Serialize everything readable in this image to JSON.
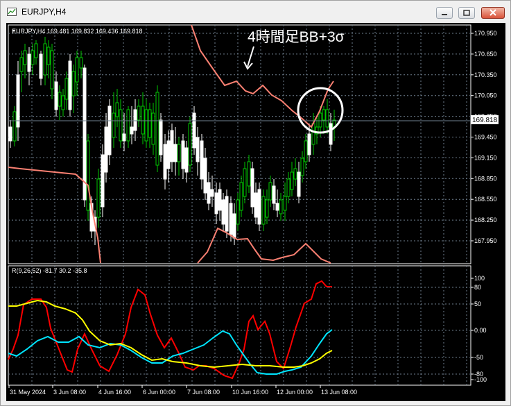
{
  "window": {
    "title": "EURJPY,H4"
  },
  "main_chart": {
    "info_line": "EURJPY,H4  169.481 169.832 169.436 169.818",
    "annotation": "4時間足BB+3σ",
    "current_price": "169.818",
    "price_ticks": [
      "170.950",
      "170.650",
      "170.350",
      "170.050",
      "169.750",
      "169.450",
      "169.150",
      "168.850",
      "168.550",
      "168.250",
      "167.950"
    ]
  },
  "indicator": {
    "label": "R(9,26,52) -81.7 30.2 -35.8",
    "ticks": [
      "100",
      "80",
      "50",
      "0.00",
      "-50",
      "-80",
      "-100"
    ]
  },
  "time_axis": {
    "labels": [
      "31 May 2024",
      "3 Jun 08:00",
      "4 Jun 16:00",
      "6 Jun 00:00",
      "7 Jun 08:00",
      "10 Jun 16:00",
      "12 Jun 00:00",
      "13 Jun 08:00"
    ]
  },
  "colors": {
    "bull_candle": "#00c800",
    "bear_candle": "#ffffff",
    "band": "#fa8072",
    "rci_short": "#ff0000",
    "rci_mid": "#00e5ff",
    "rci_long": "#ffff00",
    "grid": "#708090"
  }
}
